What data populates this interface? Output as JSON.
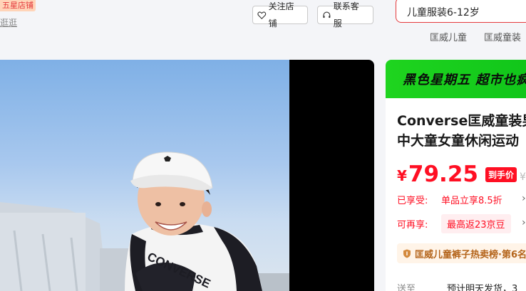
{
  "header": {
    "store_badge": "五星店铺",
    "stroll": "逛逛",
    "follow_label": "关注店铺",
    "service_label": "联系客服"
  },
  "search": {
    "value": "儿童服装6-12岁",
    "hot_links": [
      "匡威儿童",
      "匡威童装"
    ]
  },
  "product": {
    "promo": "黑色星期五 超市也疯",
    "title_line1": "Converse匡威童装男",
    "title_line2": "中大童女童休闲运动",
    "currency": "¥",
    "price": "79.25",
    "price_tag": "到手价",
    "price_more": "¥",
    "benefit1_label": "已享受:",
    "benefit1_value": "单品立享8.5折",
    "benefit2_label": "可再享:",
    "benefit2_value": "最高返23京豆",
    "rank": "匡威儿童裤子热卖榜·第6名",
    "ship_label": "送至",
    "ship_text": "预计明天发货，3"
  },
  "image_text": {
    "shirt_brand": "CONVERSE"
  },
  "colors": {
    "accent": "#ff0f23",
    "promo_green": "#10c51a",
    "search_border": "#e4393c"
  },
  "icons": {
    "follow": "heart-icon",
    "service": "headset-icon",
    "rank": "shield-icon",
    "chevron": "chevron-right-icon"
  }
}
